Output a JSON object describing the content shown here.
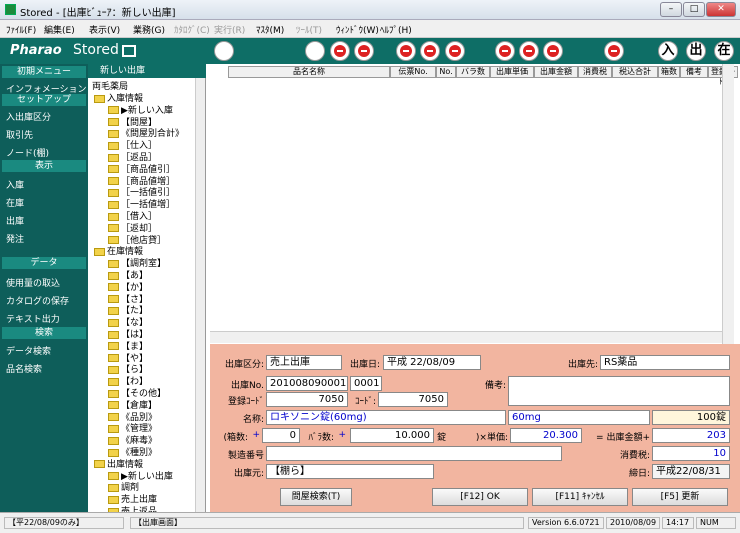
{
  "window": {
    "title": "Stored - [出庫ﾋﾞｭｰｱ：新しい出庫]"
  },
  "menu": [
    "ﾌｧｲﾙ(F)",
    "編集(E)",
    "表示(V)",
    "業務(G)",
    "ｶﾀﾛｸﾞ(C)",
    "実行(R)",
    "ﾏｽﾀ(M)",
    "ﾂｰﾙ(T)",
    "ｳｨﾝﾄﾞｳ(W)",
    "ﾍﾙﾌﾟ(H)"
  ],
  "brand": {
    "logo": "Pharao",
    "product": "Stored",
    "kanji": [
      "入",
      "出",
      "在"
    ]
  },
  "sidebar": {
    "sections": [
      {
        "title": "初期メニュー",
        "items": [
          "インフォメーション"
        ]
      },
      {
        "title": "セットアップ",
        "items": [
          "入出庫区分",
          "取引先",
          "ノード(棚)"
        ]
      },
      {
        "title": "表示",
        "items": [
          "入庫",
          "在庫",
          "出庫",
          "発注"
        ]
      },
      {
        "title": "データ",
        "items": [
          "使用量の取込",
          "カタログの保存",
          "テキスト出力"
        ]
      },
      {
        "title": "検索",
        "items": [
          "データ検索",
          "品名検索"
        ]
      }
    ]
  },
  "tree": {
    "header": "新しい出庫",
    "root": "両毛薬局",
    "items": [
      "入庫情報",
      "▶新しい入庫",
      "【問屋】",
      "《問屋別合計》",
      "［仕入］",
      "［返品］",
      "［商品値引］",
      "［商品値増］",
      "［一括値引］",
      "［一括値増］",
      "［借入］",
      "［返却］",
      "［他店貸］",
      "在庫情報",
      "【調剤室】",
      "【あ】",
      "【か】",
      "【さ】",
      "【た】",
      "【な】",
      "【は】",
      "【ま】",
      "【や】",
      "【ら】",
      "【わ】",
      "【その他】",
      "【倉庫】",
      "《品別》",
      "《管理》",
      "《麻毒》",
      "《種別》",
      "出庫情報",
      "▶新しい出庫",
      "調剤",
      "売上出庫",
      "売上返品"
    ]
  },
  "grid": {
    "headers": [
      "品名名称",
      "伝票No.",
      "No.",
      "バラ数",
      "出庫単価",
      "出庫金額",
      "消費税",
      "税込合計",
      "箱数",
      "備考",
      "登録ｺｰﾄﾞ"
    ]
  },
  "form": {
    "kubun_label": "出庫区分:",
    "kubun_value": "売上出庫",
    "date_label": "出庫日:",
    "date_value": "平成 22/08/09",
    "dest_label": "出庫先:",
    "dest_value": "RS薬品",
    "no_label": "出庫No.",
    "no_value": "201008090001",
    "no_sub": "0001",
    "remarks_label": "備考:",
    "regcode_label": "登録ｺｰﾄﾞ",
    "regcode_value": "7050",
    "code_label": "ｺｰﾄﾞ:",
    "code_value": "7050",
    "name_label": "名称:",
    "name_value": "ロキソニン錠(60mg)",
    "spec_value": "60mg",
    "unitqty_value": "100錠",
    "box_label": "(箱数:",
    "plus1": "+",
    "box_value": "0",
    "bara_label": "ﾊﾞﾗ数:",
    "plus2": "+",
    "bara_value": "10.000",
    "bara_unit": "錠",
    "price_label": ")×単価:",
    "price_value": "20.300",
    "amount_label": "= 出庫金額+",
    "amount_value": "203",
    "lot_label": "製造番号",
    "tax_label": "消費税:",
    "tax_value": "10",
    "origin_label": "出庫元:",
    "origin_value": "【棚ら】",
    "deadline_label": "締日:",
    "deadline_value": "平成22/08/31",
    "btn_search": "問屋検索(T)",
    "btn_ok": "[F12] OK",
    "btn_cancel": "[F11] ｷｬﾝｾﾙ",
    "btn_update": "[F5] 更新"
  },
  "status": {
    "left": "【平22/08/09のみ】",
    "screen": "【出庫画面】",
    "version": "Version 6.6.0721",
    "date": "2010/08/09",
    "time": "14:17",
    "num": "NUM"
  }
}
